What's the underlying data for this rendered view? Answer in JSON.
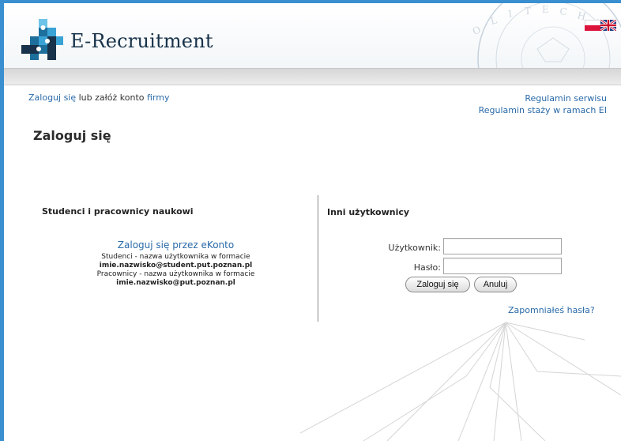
{
  "header": {
    "brand": "E-Recruitment",
    "languages": [
      "pl",
      "en"
    ],
    "accent_color": "#3a8fd0"
  },
  "topbar": {
    "login_link": "Zaloguj się",
    "middle_text": " lub załóż konto ",
    "company_link": "firmy",
    "rules_link": "Regulamin serwisu",
    "internship_rules_link": "Regulamin staży w ramach EI"
  },
  "page": {
    "title": "Zaloguj się"
  },
  "left_column": {
    "heading": "Studenci i pracownicy naukowi",
    "ekonto_link": "Zaloguj się przez eKonto",
    "students_note": "Studenci - nazwa użytkownika w formacie",
    "students_format": "imie.nazwisko@student.put.poznan.pl",
    "staff_note": "Pracownicy - nazwa użytkownika w formacie",
    "staff_format": "imie.nazwisko@put.poznan.pl"
  },
  "right_column": {
    "heading": "Inni użytkownicy",
    "username_label": "Użytkownik:",
    "username_value": "",
    "password_label": "Hasło:",
    "password_value": "",
    "login_button": "Zaloguj się",
    "cancel_button": "Anuluj",
    "forgot_link": "Zapomniałeś hasła?"
  }
}
